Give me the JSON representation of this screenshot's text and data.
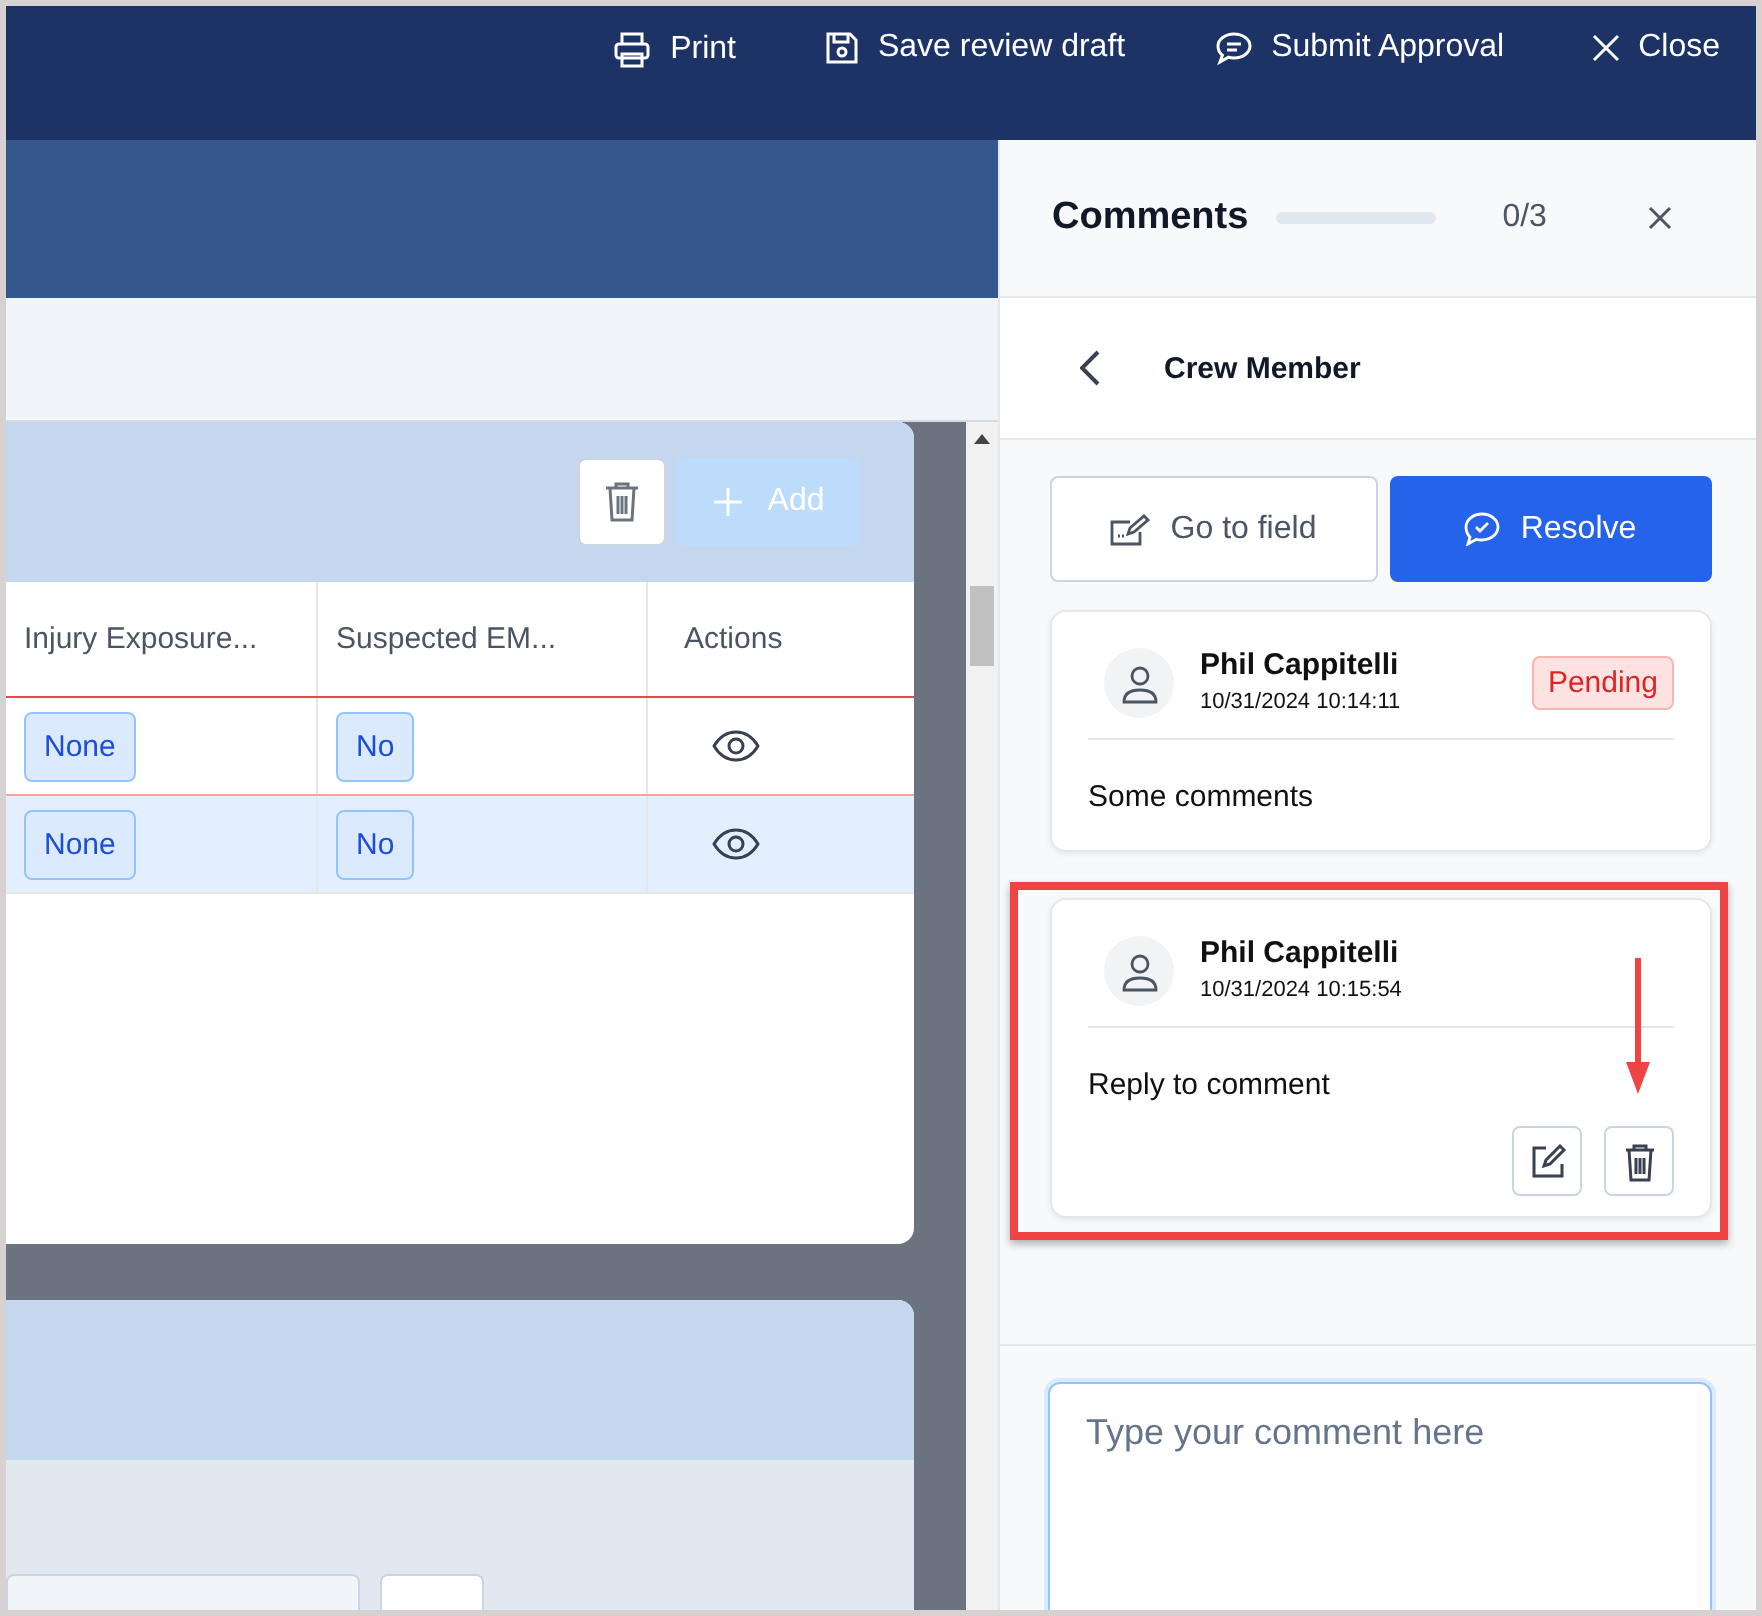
{
  "toolbar": [
    {
      "kind": "print",
      "label": "Print"
    },
    {
      "kind": "save",
      "label": "Save review draft"
    },
    {
      "kind": "submit",
      "label": "Submit Approval"
    },
    {
      "kind": "close",
      "label": "Close"
    }
  ],
  "grid_card": {
    "add_label": "Add",
    "add_disabled": true,
    "columns": [
      "Injury Exposure...",
      "Suspected EM...",
      "Actions"
    ],
    "rows": [
      {
        "cells": [
          "None",
          "No"
        ],
        "flagged": true,
        "selected": false
      },
      {
        "cells": [
          "None",
          "No"
        ],
        "flagged": false,
        "selected": true
      }
    ]
  },
  "comments_panel": {
    "title": "Comments",
    "progress": {
      "level": 0
    },
    "count": "0/3",
    "section": "Crew Member",
    "go_to_field": "Go to field",
    "resolve": "Resolve",
    "comments": [
      {
        "author": "Phil Cappitelli",
        "time": "10/31/2024 10:14:11",
        "status": "Pending",
        "text": "Some comments",
        "own": false,
        "annotated": false
      },
      {
        "author": "Phil Cappitelli",
        "time": "10/31/2024 10:15:54",
        "text": "Reply to comment",
        "own": true,
        "annotated": true
      }
    ],
    "input": {
      "placeholder": "Type your comment here"
    }
  }
}
